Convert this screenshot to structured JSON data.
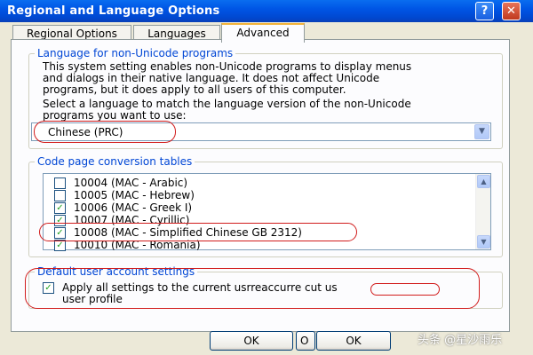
{
  "window": {
    "title": "Regional and Language Options",
    "help_glyph": "?",
    "close_glyph": "✕"
  },
  "tabs": [
    {
      "label": "Regional Options",
      "active": false
    },
    {
      "label": "Languages",
      "active": false
    },
    {
      "label": "Advanced",
      "active": true
    }
  ],
  "non_unicode": {
    "legend": "Language for non-Unicode programs",
    "description": [
      "This system setting enables non-Unicode programs to display menus",
      "and dialogs in their native language. It does not affect Unicode",
      "programs, but it does apply to all users of this computer."
    ],
    "select_prompt": [
      "Select a language to match the language version of the non-Unicode",
      "programs you want to use:"
    ],
    "selected_language": "Chinese (PRC)",
    "dropdown_glyph": "▼"
  },
  "code_pages": {
    "legend": "Code page conversion tables",
    "scroll_up_glyph": "▲",
    "scroll_down_glyph": "▼",
    "items": [
      {
        "label": "10004 (MAC - Arabic)",
        "checked": false
      },
      {
        "label": "10005 (MAC - Hebrew)",
        "checked": false
      },
      {
        "label": "10006 (MAC - Greek I)",
        "checked": true
      },
      {
        "label": "10007 (MAC - Cyrillic)",
        "checked": true
      },
      {
        "label": "10008 (MAC - Simplified Chinese GB 2312)",
        "checked": true
      },
      {
        "label": "10010 (MAC - Romania)",
        "checked": true
      }
    ]
  },
  "default_user": {
    "legend": "Default user account settings",
    "checkbox_label_line1": "Apply all settings to the current usrreaccurre cut us",
    "checkbox_label_line2": "user profile",
    "checked": true
  },
  "buttons": {
    "ok_label": "OK",
    "partial_label": "O",
    "ok2_label": "OK"
  },
  "watermark": "头条 @星沙雨乐",
  "colors": {
    "title_bar": "#0055e5",
    "legend_text": "#0046d5",
    "annotation_red": "#d11c1c",
    "check_green": "#21a121"
  }
}
